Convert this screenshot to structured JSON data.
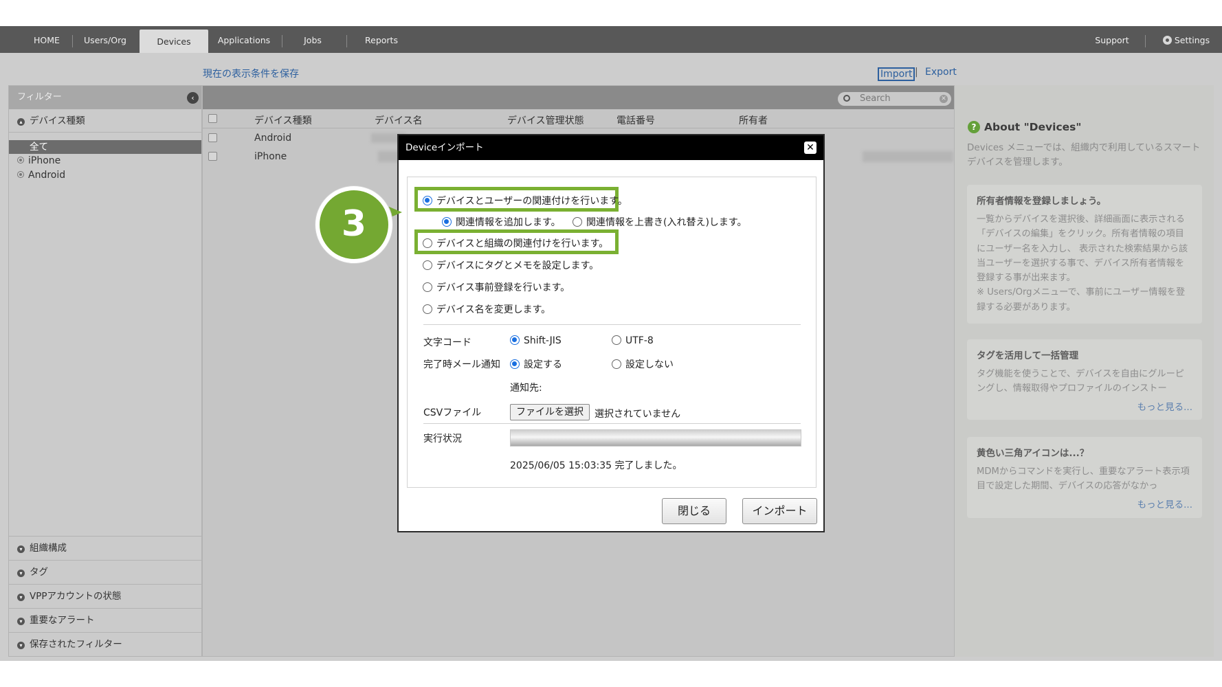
{
  "nav": {
    "tabs": [
      "HOME",
      "Users/Org",
      "Devices",
      "Applications",
      "Jobs",
      "Reports"
    ],
    "active_tab": "Devices",
    "support": "Support",
    "settings": "Settings"
  },
  "toolbar": {
    "save_view": "現在の表示条件を保存",
    "import": "Import",
    "separator": "|",
    "export": "Export"
  },
  "sidebar": {
    "header": "フィルター",
    "device_type_section": "デバイス種類",
    "items": [
      "全て",
      "iPhone",
      "Android"
    ],
    "bottom_sections": [
      "組織構成",
      "タグ",
      "VPPアカウントの状態",
      "重要なアラート",
      "保存されたフィルター"
    ]
  },
  "table": {
    "search_placeholder": "Search",
    "columns": [
      "デバイス種類",
      "デバイス名",
      "デバイス管理状態",
      "電話番号",
      "所有者"
    ],
    "rows": [
      {
        "type": "Android"
      },
      {
        "type": "iPhone"
      }
    ]
  },
  "right_panel": {
    "about_title": "About \"Devices\"",
    "about_text": "Devices メニューでは、組織内で利用しているスマートデバイスを管理します。",
    "cards": [
      {
        "title": "所有者情報を登録しましょう。",
        "body": "一覧からデバイスを選択後、詳細画面に表示される「デバイスの編集」をクリック。所有者情報の項目にユーザー名を入力し、 表示された検索結果から該当ユーザーを選択する事で、デバイス所有者情報を登録する事が出来ます。\n※ Users/Orgメニューで、事前にユーザー情報を登録する必要があります。",
        "more": ""
      },
      {
        "title": "タグを活用して一括管理",
        "body": "タグ機能を使うことで、デバイスを自由にグルーピングし、情報取得やプロファイルのインストー",
        "more": "もっと見る..."
      },
      {
        "title": "黄色い三角アイコンは...？",
        "body": "MDMからコマンドを実行し、重要なアラート表示項目で設定した期間、デバイスの応答がなかっ",
        "more": "もっと見る..."
      }
    ]
  },
  "modal": {
    "title": "Deviceインポート",
    "close": "✕",
    "options": {
      "user_link": "デバイスとユーザーの関連付けを行います。",
      "add_info": "関連情報を追加します。",
      "overwrite_info": "関連情報を上書き(入れ替え)します。",
      "org_link": "デバイスと組織の関連付けを行います。",
      "tag_memo": "デバイスにタグとメモを設定します。",
      "pre_register": "デバイス事前登録を行います。",
      "rename": "デバイス名を変更します。"
    },
    "charset_label": "文字コード",
    "charset_options": [
      "Shift-JIS",
      "UTF-8"
    ],
    "mail_label": "完了時メール通知",
    "mail_options": [
      "設定する",
      "設定しない"
    ],
    "notify_to": "通知先:",
    "csv_label": "CSVファイル",
    "file_button": "ファイルを選択",
    "file_status": "選択されていません",
    "progress_label": "実行状況",
    "progress_value": 1.0,
    "status_message": "2025/06/05 15:03:35 完了しました。",
    "close_button": "閉じる",
    "import_button": "インポート"
  },
  "callout": {
    "step_number": "3",
    "color": "#74a832"
  }
}
